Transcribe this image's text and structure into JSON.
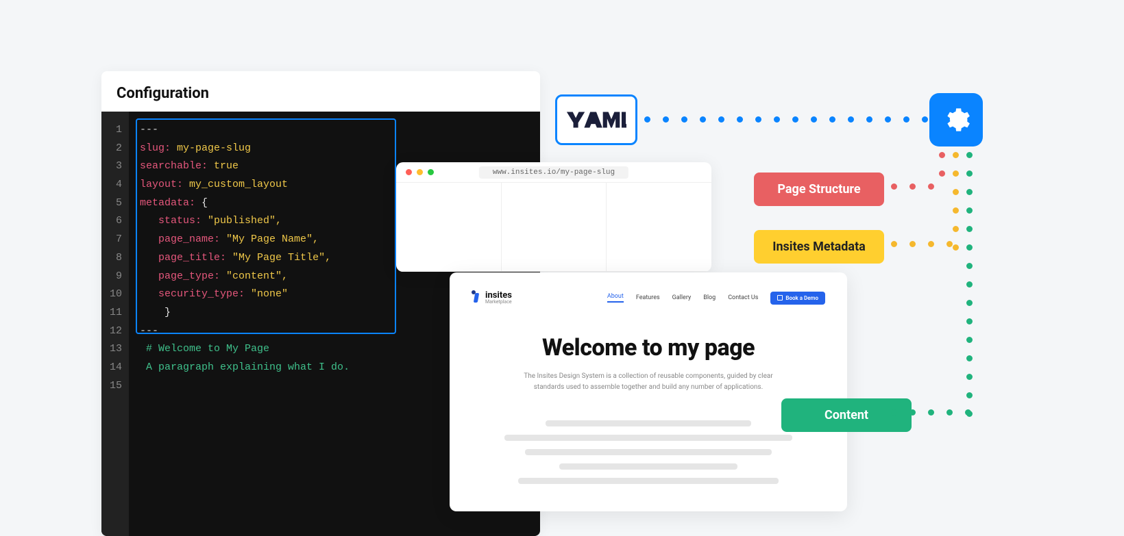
{
  "config": {
    "title": "Configuration",
    "line_numbers": [
      "1",
      "2",
      "3",
      "4",
      "5",
      "6",
      "7",
      "8",
      "9",
      "10",
      "11",
      "12",
      "13",
      "14",
      "15"
    ],
    "yaml": {
      "open_dashes": "---",
      "slug_key": "slug:",
      "slug_val": " my-page-slug",
      "searchable_key": "searchable:",
      "searchable_val": " true",
      "layout_key": "layout:",
      "layout_val": " my_custom_layout",
      "metadata_key": "metadata:",
      "brace_open": " {",
      "status_key": "status:",
      "status_val": " \"published\",",
      "page_name_key": "page_name:",
      "page_name_val": " \"My Page Name\",",
      "page_title_key": "page_title:",
      "page_title_val": " \"My Page Title\",",
      "page_type_key": "page_type:",
      "page_type_val": " \"content\",",
      "security_key": "security_type:",
      "security_val": " \"none\"",
      "brace_close": "}",
      "close_dashes": "---",
      "heading_comment": "# Welcome to My Page",
      "paragraph_comment": "A paragraph explaining what I do."
    }
  },
  "browser": {
    "url": "www.insites.io/my-page-slug"
  },
  "webpage": {
    "brand_name": "insites",
    "brand_sub": "Marketplace",
    "nav": {
      "about": "About",
      "features": "Features",
      "gallery": "Gallery",
      "blog": "Blog",
      "contact": "Contact Us"
    },
    "cta": "Book a Demo",
    "hero_title": "Welcome to my page",
    "hero_sub": "The Insites Design System is a collection of reusable components, guided by clear standards used to assemble together and build any number of applications."
  },
  "badges": {
    "yaml": "YAML",
    "page_structure": "Page Structure",
    "insites_metadata": "Insites Metadata",
    "content": "Content"
  },
  "colors": {
    "blue": "#0a84ff",
    "red": "#e86062",
    "yellow": "#ffcf2f",
    "green": "#20b37d"
  }
}
